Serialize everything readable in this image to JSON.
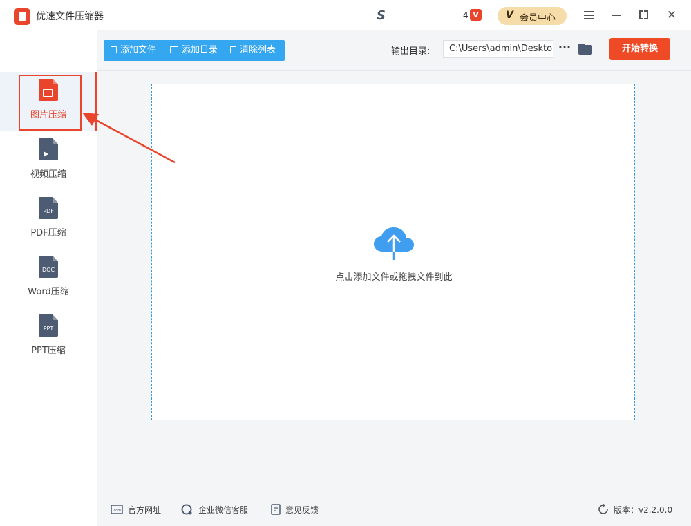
{
  "app": {
    "title": "优速文件压缩器",
    "brand_mark": "S"
  },
  "header": {
    "message_count": "4",
    "message_icon": "vip-message-icon",
    "vip_mark": "V",
    "vip_label": "会员中心"
  },
  "sidebar": {
    "items": [
      {
        "label": "图片压缩",
        "badge": "",
        "icon": "image-file-icon",
        "active": true
      },
      {
        "label": "视频压缩",
        "badge": "",
        "icon": "video-file-icon",
        "active": false
      },
      {
        "label": "PDF压缩",
        "badge": "PDF",
        "icon": "pdf-file-icon",
        "active": false
      },
      {
        "label": "Word压缩",
        "badge": "DOC",
        "icon": "doc-file-icon",
        "active": false
      },
      {
        "label": "PPT压缩",
        "badge": "PPT",
        "icon": "ppt-file-icon",
        "active": false
      }
    ]
  },
  "toolbar": {
    "add_file": "添加文件",
    "add_dir": "添加目录",
    "clear_list": "清除列表",
    "output_label": "输出目录:",
    "output_path": "C:\\Users\\admin\\Desktop",
    "more": "···",
    "start": "开始转换"
  },
  "dropzone": {
    "hint": "点击添加文件或拖拽文件到此"
  },
  "footer": {
    "website": "官方网址",
    "website_icon_text": ".com",
    "wechat": "企业微信客服",
    "feedback": "意见反馈",
    "version": "版本：v2.2.0.0"
  },
  "colors": {
    "accent": "#e8452c",
    "primary_blue": "#35a6f0",
    "start_button": "#ee4a25",
    "vip_bg": "#f6dca9",
    "icon_gray": "#4d5b73"
  }
}
